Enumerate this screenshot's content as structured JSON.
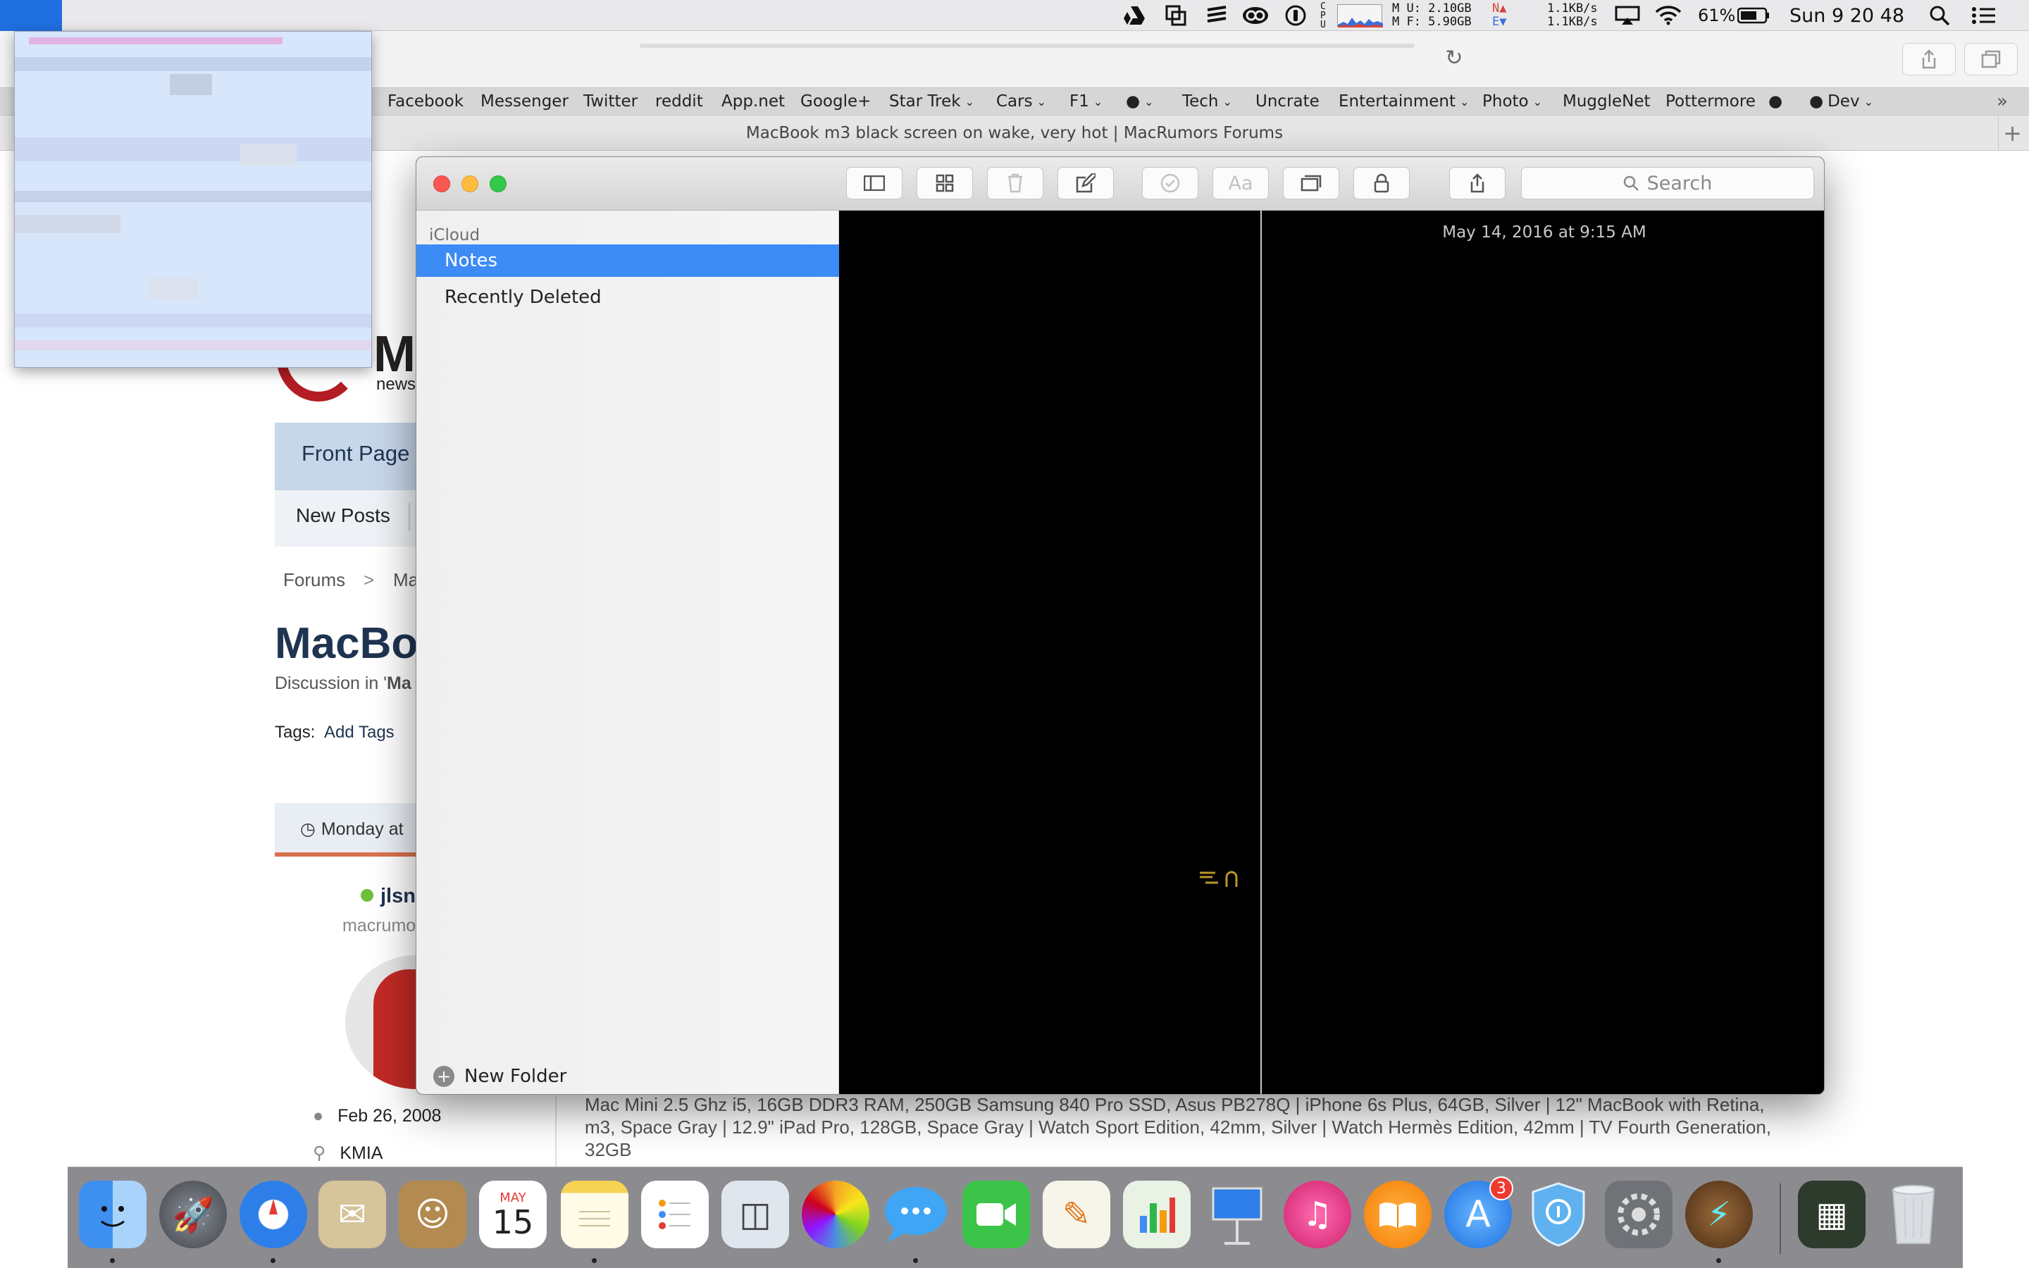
{
  "menubar": {
    "mem_used": "M U: 2.10GB",
    "mem_free": "M F: 5.90GB",
    "net_up": "1.1KB/s",
    "net_down": "1.1KB/s",
    "battery": "61%",
    "clock": "Sun 9 20 48"
  },
  "bookmarks": [
    "Facebook",
    "Messenger",
    "Twitter",
    "reddit",
    "App.net",
    "Google+",
    "Star Trek",
    "Cars",
    "F1",
    "",
    "Tech",
    "Uncrate",
    "Entertainment",
    "Photo",
    "MuggleNet",
    "Pottermore",
    "",
    "Dev"
  ],
  "tab": {
    "title": "MacBook m3 black screen on wake, very hot | MacRumors Forums"
  },
  "webpage": {
    "logo_letter": "M",
    "logo_sub": "news",
    "nav_front": "Front Page",
    "nav_new_posts": "New Posts",
    "breadcrumb_forums": "Forums",
    "breadcrumb_sep": ">",
    "breadcrumb_next": "Ma",
    "thread_title": "MacBo",
    "discussion_prefix": "Discussion in '",
    "discussion_bold": "Ma",
    "tags_label": "Tags:",
    "tags_link": "Add Tags",
    "post_date": "Monday at",
    "username": "jlsn",
    "user_title": "macrumo",
    "join_date": "Feb 26, 2008",
    "location": "KMIA",
    "signature": " Mac Mini 2.5 Ghz i5, 16GB DDR3 RAM, 250GB Samsung 840 Pro SSD, Asus PB278Q |  iPhone 6s Plus, 64GB, Silver |  12\" MacBook with Retina, m3, Space Gray |  12.9\" iPad Pro, 128GB, Space Gray |  Watch Sport Edition, 42mm, Silver |  Watch Hermès Edition, 42mm |  TV Fourth Generation, 32GB"
  },
  "notes": {
    "section_label": "iCloud",
    "folders": [
      "Notes",
      "Recently Deleted"
    ],
    "search_placeholder": "Search",
    "note_date": "May 14, 2016 at 9:15 AM",
    "new_folder": "New Folder"
  },
  "dock": {
    "calendar_month": "MAY",
    "calendar_day": "15",
    "appstore_badge": "3"
  },
  "colors": {
    "selection_blue": "#3d8bf5",
    "menubar_bg": "#e9e9eb",
    "badge_red": "#ee3b30"
  }
}
